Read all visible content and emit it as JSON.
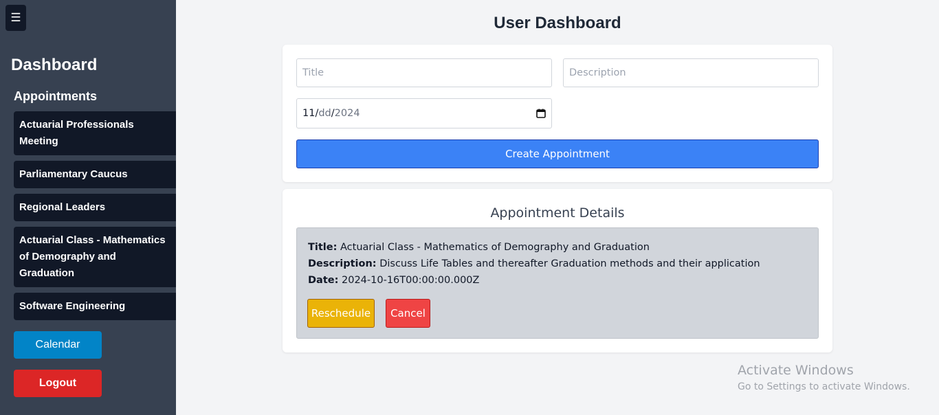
{
  "sidebar": {
    "menu_icon": "hamburger-icon",
    "menu_glyph": "☰",
    "title": "Dashboard",
    "section": "Appointments",
    "appointments": [
      "Actuarial Professionals Meeting",
      "Parliamentary Caucus",
      "Regional Leaders",
      "Actuarial Class - Mathematics of Demography and Graduation",
      "Software Engineering"
    ],
    "calendar_label": "Calendar",
    "logout_label": "Logout"
  },
  "main": {
    "title": "User Dashboard",
    "form": {
      "title_placeholder": "Title",
      "description_placeholder": "Description",
      "date_month": "11",
      "date_sep1": "/",
      "date_day": "dd",
      "date_sep2": "/",
      "date_year": "2024",
      "date_icon": "calendar-icon",
      "create_label": "Create Appointment"
    },
    "details": {
      "heading": "Appointment Details",
      "title_label": "Title:",
      "title_value": "Actuarial Class - Mathematics of Demography and Graduation",
      "description_label": "Description:",
      "description_value": "Discuss Life Tables and thereafter Graduation methods and their application",
      "date_label": "Date:",
      "date_value": "2024-10-16T00:00:00.000Z",
      "reschedule_label": "Reschedule",
      "cancel_label": "Cancel"
    }
  },
  "watermark": {
    "line1": "Activate Windows",
    "line2": "Go to Settings to activate Windows."
  },
  "colors": {
    "sidebar_bg": "#374151",
    "item_bg": "#111827",
    "primary": "#3b82f6",
    "calendar_btn": "#0284c7",
    "logout_btn": "#dc2626",
    "reschedule_btn": "#eab308",
    "cancel_btn": "#ef4444"
  }
}
